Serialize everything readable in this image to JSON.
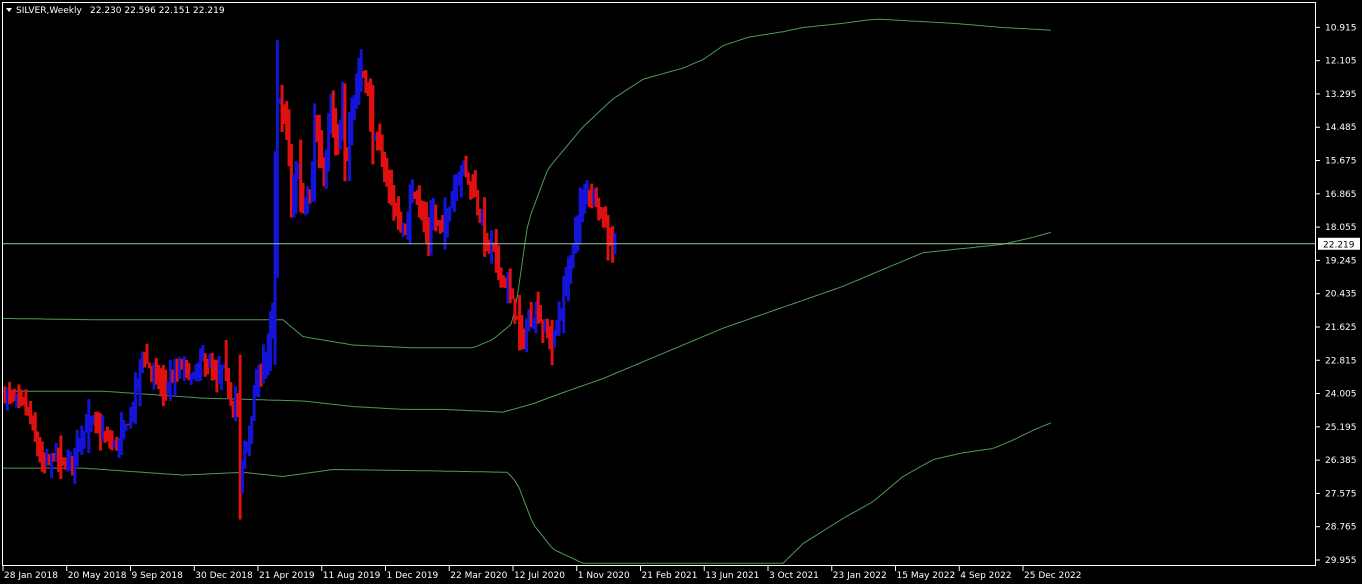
{
  "header": {
    "symbol_timeframe": "SILVER,Weekly",
    "ohlc": "22.230 22.596 22.151 22.219"
  },
  "colors": {
    "background": "#000000",
    "frame": "#ffffff",
    "bull": "#1414d8",
    "bear": "#e01010",
    "envelope": "#4f9a58",
    "price_line": "#8fc7a0",
    "price_label_bg": "#ffffff"
  },
  "chart_data": {
    "type": "bar",
    "style": "high-low bars",
    "timeframe": "Weekly",
    "ylim": [
      10.91,
      30.4
    ],
    "current_price": 22.219,
    "current_price_label": "22.219",
    "y_ticks": [
      "29.955",
      "28.765",
      "27.575",
      "26.385",
      "25.195",
      "24.005",
      "22.815",
      "21.625",
      "20.435",
      "19.245",
      "18.055",
      "16.865",
      "15.675",
      "14.485",
      "13.295",
      "12.105",
      "10.915"
    ],
    "x_ticks": [
      "28 Jan 2018",
      "20 May 2018",
      "9 Sep 2018",
      "30 Dec 2018",
      "21 Apr 2019",
      "11 Aug 2019",
      "1 Dec 2019",
      "22 Mar 2020",
      "12 Jul 2020",
      "1 Nov 2020",
      "21 Feb 2021",
      "13 Jun 2021",
      "3 Oct 2021",
      "23 Jan 2022",
      "15 May 2022",
      "4 Sep 2022",
      "25 Dec 2022"
    ],
    "bar_count": 263,
    "price_path": [
      [
        0,
        16.9
      ],
      [
        10,
        16.7
      ],
      [
        15,
        16.6
      ],
      [
        20,
        16.5
      ],
      [
        25,
        16.3
      ],
      [
        30,
        15.6
      ],
      [
        35,
        14.9
      ],
      [
        40,
        14.3
      ],
      [
        45,
        14.4
      ],
      [
        50,
        14.6
      ],
      [
        55,
        14.7
      ],
      [
        60,
        14.3
      ],
      [
        65,
        14.4
      ],
      [
        70,
        14.6
      ],
      [
        75,
        15.2
      ],
      [
        80,
        15.4
      ],
      [
        85,
        15.7
      ],
      [
        90,
        15.9
      ],
      [
        95,
        15.6
      ],
      [
        100,
        15.3
      ],
      [
        105,
        15.2
      ],
      [
        110,
        15.0
      ],
      [
        115,
        15.1
      ],
      [
        120,
        15.4
      ],
      [
        125,
        15.8
      ],
      [
        130,
        16.4
      ],
      [
        135,
        17.4
      ],
      [
        140,
        18.3
      ],
      [
        145,
        17.9
      ],
      [
        150,
        17.6
      ],
      [
        155,
        17.4
      ],
      [
        160,
        17.1
      ],
      [
        165,
        17.2
      ],
      [
        170,
        17.4
      ],
      [
        175,
        17.6
      ],
      [
        180,
        17.9
      ],
      [
        185,
        17.6
      ],
      [
        190,
        17.3
      ],
      [
        195,
        17.7
      ],
      [
        200,
        18.1
      ],
      [
        205,
        17.9
      ],
      [
        210,
        17.6
      ],
      [
        215,
        17.2
      ],
      [
        220,
        17.9
      ],
      [
        225,
        17.2
      ],
      [
        230,
        16.4
      ],
      [
        235,
        16.7
      ],
      [
        237,
        13.6
      ],
      [
        240,
        14.4
      ],
      [
        245,
        15.2
      ],
      [
        250,
        16.4
      ],
      [
        255,
        17.2
      ],
      [
        260,
        17.9
      ],
      [
        265,
        18.4
      ],
      [
        270,
        19.4
      ],
      [
        272,
        22.4
      ],
      [
        274,
        26.5
      ],
      [
        276,
        28.2
      ],
      [
        278,
        26.8
      ],
      [
        280,
        27.1
      ],
      [
        285,
        26.3
      ],
      [
        289,
        23.3
      ],
      [
        292,
        24.2
      ],
      [
        295,
        25.2
      ],
      [
        300,
        23.4
      ],
      [
        305,
        24.1
      ],
      [
        308,
        24.0
      ],
      [
        312,
        26.2
      ],
      [
        315,
        25.9
      ],
      [
        320,
        24.5
      ],
      [
        325,
        25.6
      ],
      [
        328,
        27.2
      ],
      [
        330,
        26.7
      ],
      [
        335,
        25.4
      ],
      [
        340,
        26.9
      ],
      [
        343,
        24.9
      ],
      [
        347,
        26.3
      ],
      [
        350,
        27.3
      ],
      [
        355,
        28.1
      ],
      [
        360,
        28.5
      ],
      [
        365,
        27.7
      ],
      [
        370,
        26.1
      ],
      [
        375,
        25.7
      ],
      [
        380,
        25.1
      ],
      [
        385,
        24.6
      ],
      [
        390,
        23.8
      ],
      [
        395,
        23.0
      ],
      [
        400,
        22.6
      ],
      [
        405,
        22.9
      ],
      [
        410,
        24.2
      ],
      [
        415,
        24.0
      ],
      [
        420,
        23.1
      ],
      [
        425,
        22.4
      ],
      [
        430,
        23.2
      ],
      [
        435,
        23.0
      ],
      [
        440,
        22.7
      ],
      [
        445,
        23.4
      ],
      [
        450,
        24.0
      ],
      [
        455,
        24.6
      ],
      [
        460,
        25.1
      ],
      [
        465,
        24.5
      ],
      [
        470,
        24.3
      ],
      [
        475,
        23.5
      ],
      [
        480,
        23.0
      ],
      [
        485,
        22.0
      ],
      [
        490,
        22.2
      ],
      [
        495,
        21.5
      ],
      [
        500,
        21.0
      ],
      [
        505,
        20.6
      ],
      [
        510,
        20.1
      ],
      [
        515,
        19.4
      ],
      [
        520,
        18.7
      ],
      [
        525,
        19.2
      ],
      [
        530,
        19.7
      ],
      [
        535,
        19.9
      ],
      [
        540,
        19.2
      ],
      [
        545,
        19.0
      ],
      [
        550,
        18.7
      ],
      [
        555,
        19.3
      ],
      [
        560,
        20.1
      ],
      [
        565,
        21.1
      ],
      [
        570,
        21.9
      ],
      [
        575,
        23.1
      ],
      [
        580,
        23.7
      ],
      [
        585,
        24.1
      ],
      [
        590,
        23.9
      ],
      [
        595,
        23.8
      ],
      [
        600,
        23.2
      ],
      [
        605,
        22.6
      ],
      [
        610,
        22.2
      ]
    ],
    "envelope_upper": [
      [
        0,
        19.55
      ],
      [
        100,
        19.5
      ],
      [
        280,
        19.5
      ],
      [
        300,
        18.9
      ],
      [
        350,
        18.6
      ],
      [
        410,
        18.5
      ],
      [
        470,
        18.5
      ],
      [
        490,
        18.8
      ],
      [
        510,
        19.4
      ],
      [
        515,
        20.5
      ],
      [
        525,
        23.0
      ],
      [
        545,
        24.9
      ],
      [
        580,
        26.4
      ],
      [
        610,
        27.4
      ],
      [
        640,
        28.1
      ],
      [
        680,
        28.5
      ],
      [
        700,
        28.8
      ],
      [
        720,
        29.3
      ],
      [
        745,
        29.6
      ],
      [
        780,
        29.8
      ],
      [
        800,
        29.95
      ],
      [
        840,
        30.1
      ],
      [
        860,
        30.2
      ],
      [
        875,
        30.25
      ],
      [
        900,
        30.2
      ],
      [
        950,
        30.1
      ],
      [
        1000,
        29.95
      ],
      [
        1050,
        29.85
      ]
    ],
    "envelope_middle": [
      [
        0,
        16.95
      ],
      [
        100,
        16.95
      ],
      [
        200,
        16.7
      ],
      [
        300,
        16.6
      ],
      [
        350,
        16.4
      ],
      [
        400,
        16.3
      ],
      [
        440,
        16.3
      ],
      [
        470,
        16.25
      ],
      [
        500,
        16.2
      ],
      [
        530,
        16.5
      ],
      [
        560,
        16.9
      ],
      [
        600,
        17.4
      ],
      [
        640,
        18.0
      ],
      [
        680,
        18.6
      ],
      [
        720,
        19.2
      ],
      [
        760,
        19.7
      ],
      [
        800,
        20.2
      ],
      [
        840,
        20.7
      ],
      [
        880,
        21.3
      ],
      [
        900,
        21.6
      ],
      [
        920,
        21.9
      ],
      [
        960,
        22.05
      ],
      [
        1000,
        22.2
      ],
      [
        1030,
        22.45
      ],
      [
        1050,
        22.65
      ]
    ],
    "envelope_lower": [
      [
        0,
        14.2
      ],
      [
        80,
        14.2
      ],
      [
        180,
        13.95
      ],
      [
        240,
        14.05
      ],
      [
        280,
        13.9
      ],
      [
        330,
        14.15
      ],
      [
        430,
        14.1
      ],
      [
        505,
        14.05
      ],
      [
        515,
        13.6
      ],
      [
        530,
        12.2
      ],
      [
        550,
        11.3
      ],
      [
        580,
        10.8
      ],
      [
        780,
        10.8
      ],
      [
        800,
        11.5
      ],
      [
        840,
        12.4
      ],
      [
        870,
        13.0
      ],
      [
        900,
        13.9
      ],
      [
        930,
        14.5
      ],
      [
        960,
        14.75
      ],
      [
        990,
        14.9
      ],
      [
        1010,
        15.2
      ],
      [
        1030,
        15.55
      ],
      [
        1050,
        15.85
      ]
    ]
  }
}
